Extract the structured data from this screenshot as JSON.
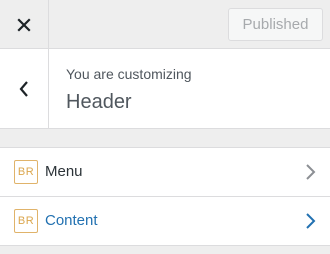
{
  "topbar": {
    "close_icon": "close-icon",
    "publish_label": "Published"
  },
  "customize": {
    "back_icon": "chevron-left-icon",
    "customizing_label": "You are customizing",
    "panel_title": "Header"
  },
  "sections": [
    {
      "badge": "BR",
      "label": "Menu",
      "icon": "chevron-right-icon",
      "active": false
    },
    {
      "badge": "BR",
      "label": "Content",
      "icon": "chevron-right-icon",
      "active": true
    }
  ],
  "colors": {
    "accent": "#2271b1",
    "badge": "#dba64d",
    "text": "#2c3338",
    "muted": "#a7aaad"
  }
}
